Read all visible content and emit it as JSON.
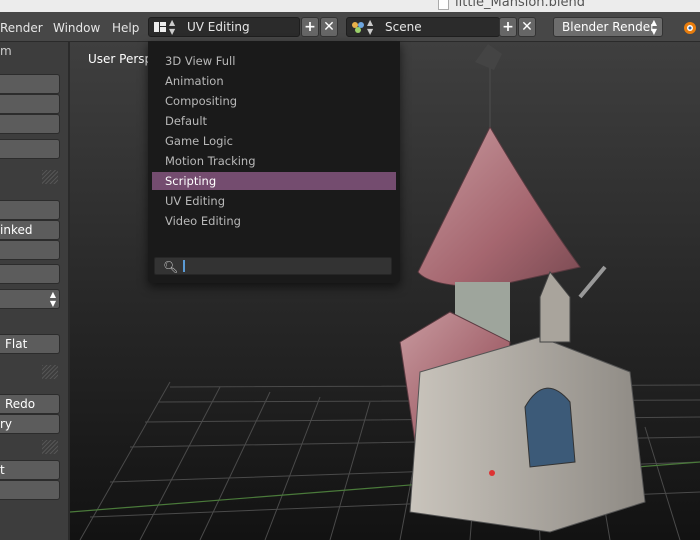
{
  "titlebar": {
    "file_title": "little_Mansion.blend"
  },
  "infobar": {
    "menus": [
      "Render",
      "Window",
      "Help"
    ],
    "screen_layout": "UV Editing",
    "scene": "Scene",
    "render_engine": "Blender Render"
  },
  "shelf": {
    "fragments": [
      "m",
      "inked",
      "Flat",
      "Redo",
      "ry",
      "t"
    ]
  },
  "viewport": {
    "label": "User Persp"
  },
  "dropdown": {
    "items": [
      "3D View Full",
      "Animation",
      "Compositing",
      "Default",
      "Game Logic",
      "Motion Tracking",
      "Scripting",
      "UV Editing",
      "Video Editing"
    ],
    "selected": "Scripting",
    "search_value": ""
  },
  "colors": {
    "highlight": "#744c6f",
    "accent": "#5b9bd5"
  }
}
